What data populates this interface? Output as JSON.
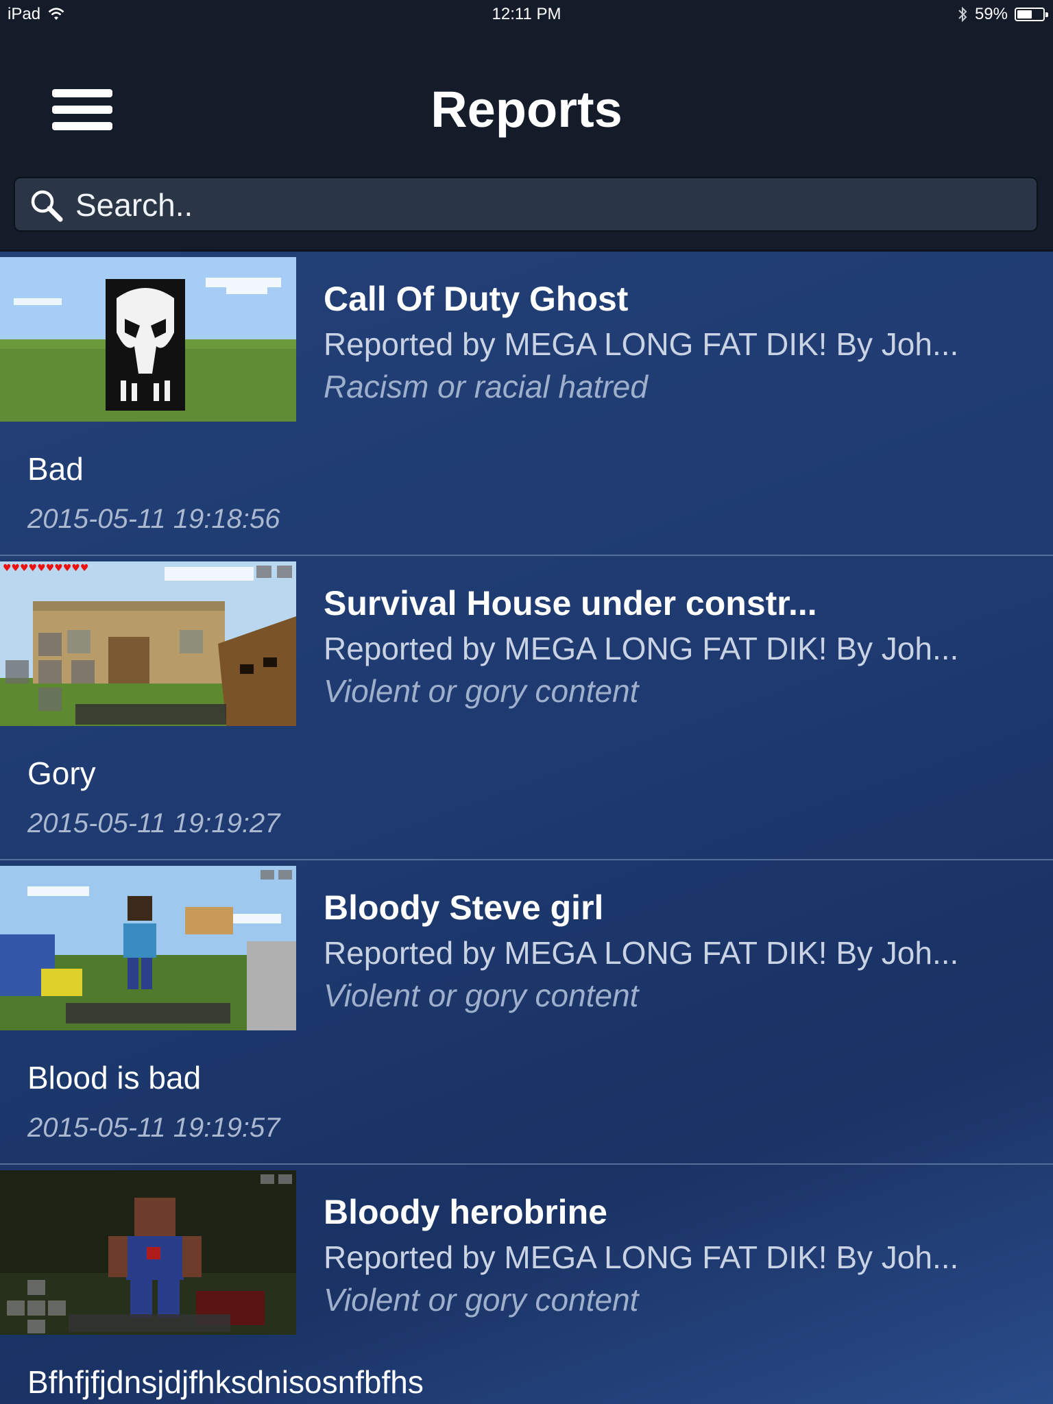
{
  "status_bar": {
    "device": "iPad",
    "time": "12:11 PM",
    "battery_percent_label": "59%",
    "battery_level": 0.59
  },
  "nav": {
    "title": "Reports",
    "menu_icon": "hamburger-menu-icon"
  },
  "search": {
    "placeholder": "Search..",
    "icon": "search-icon"
  },
  "reports": [
    {
      "title": "Call Of Duty Ghost",
      "reporter": "Reported by MEGA LONG FAT DIK! By Joh...",
      "reason": "Racism or racial hatred",
      "comment": "Bad",
      "date": "2015-05-11 19:18:56"
    },
    {
      "title": "Survival House under constr...",
      "reporter": "Reported by MEGA LONG FAT DIK! By Joh...",
      "reason": "Violent or gory content",
      "comment": "Gory",
      "date": "2015-05-11 19:19:27"
    },
    {
      "title": "Bloody Steve girl",
      "reporter": "Reported by MEGA LONG FAT DIK! By Joh...",
      "reason": "Violent or gory content",
      "comment": "Blood is bad",
      "date": "2015-05-11 19:19:57"
    },
    {
      "title": "Bloody herobrine",
      "reporter": "Reported by MEGA LONG FAT DIK! By Joh...",
      "reason": "Violent or gory content",
      "comment": "Bfhfjfjdnsjdjfhksdnisosnfbfhs",
      "date": ""
    }
  ]
}
